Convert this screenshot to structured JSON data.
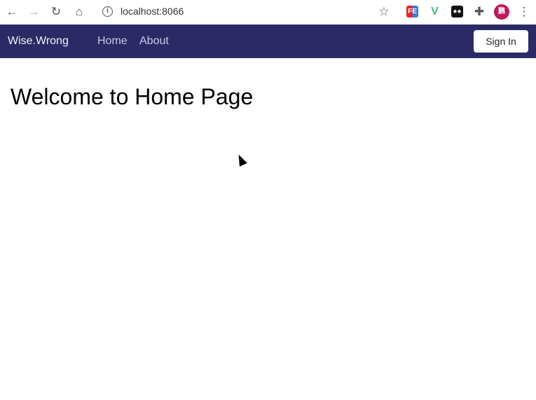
{
  "browser": {
    "url": "localhost:8066",
    "icons": [
      "back-icon",
      "forward-icon",
      "reload-icon",
      "home-icon",
      "info-icon",
      "star-icon",
      "fe-extension-icon",
      "vue-devtools-icon",
      "tampermonkey-icon",
      "extensions-puzzle-icon",
      "profile-avatar",
      "menu-dots-icon"
    ],
    "avatar_text": "鹏",
    "fe_text": "FE"
  },
  "navbar": {
    "brand": "Wise.Wrong",
    "links": [
      "Home",
      "About"
    ],
    "sign_in": "Sign In",
    "color": "#2c2a66"
  },
  "main": {
    "title": "Welcome to Home Page"
  }
}
